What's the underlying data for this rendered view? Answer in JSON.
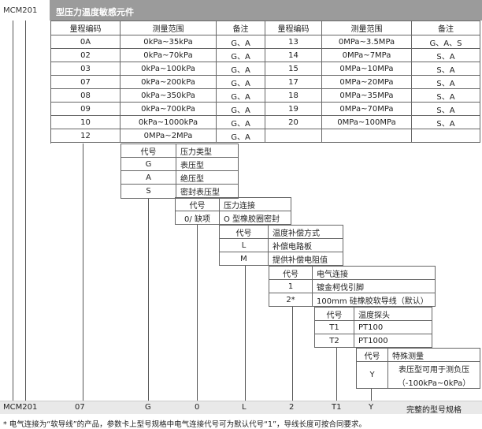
{
  "header": {
    "model": "MCM201",
    "title": "型压力温度敏感元件"
  },
  "range_table": {
    "headers": [
      "量程编码",
      "测量范围",
      "备注",
      "量程编码",
      "测量范围",
      "备注"
    ],
    "left_rows": [
      [
        "0A",
        "0kPa~35kPa",
        "G、A"
      ],
      [
        "02",
        "0kPa~70kPa",
        "G、A"
      ],
      [
        "03",
        "0kPa~100kPa",
        "G、A"
      ],
      [
        "07",
        "0kPa~200kPa",
        "G、A"
      ],
      [
        "08",
        "0kPa~350kPa",
        "G、A"
      ],
      [
        "09",
        "0kPa~700kPa",
        "G、A"
      ],
      [
        "10",
        "0kPa~1000kPa",
        "G、A"
      ],
      [
        "12",
        "0MPa~2MPa",
        "G、A"
      ]
    ],
    "right_rows": [
      [
        "13",
        "0MPa~3.5MPa",
        "G、A、S"
      ],
      [
        "14",
        "0MPa~7MPa",
        "S、A"
      ],
      [
        "15",
        "0MPa~10MPa",
        "S、A"
      ],
      [
        "17",
        "0MPa~20MPa",
        "S、A"
      ],
      [
        "18",
        "0MPa~35MPa",
        "S、A"
      ],
      [
        "19",
        "0MPa~70MPa",
        "S、A"
      ],
      [
        "20",
        "0MPa~100MPa",
        "S、A"
      ]
    ]
  },
  "pressure_type": {
    "code_header": "代号",
    "title": "压力类型",
    "rows": [
      [
        "G",
        "表压型"
      ],
      [
        "A",
        "绝压型"
      ],
      [
        "S",
        "密封表压型"
      ]
    ]
  },
  "pressure_conn": {
    "code_header": "代号",
    "title": "压力连接",
    "rows": [
      [
        "0/ 缺项",
        "O 型橡胶圈密封"
      ]
    ]
  },
  "temp_comp": {
    "code_header": "代号",
    "title": "温度补偿方式",
    "rows": [
      [
        "L",
        "补偿电路板"
      ],
      [
        "M",
        "提供补偿电阻值"
      ]
    ]
  },
  "elec_conn": {
    "code_header": "代号",
    "title": "电气连接",
    "rows": [
      [
        "1",
        "镀金柯伐引脚"
      ],
      [
        "2*",
        "100mm 硅橡胶软导线（默认）"
      ]
    ]
  },
  "temp_probe": {
    "code_header": "代号",
    "title": "温度探头",
    "rows": [
      [
        "T1",
        "PT100"
      ],
      [
        "T2",
        "PT1000"
      ]
    ]
  },
  "special": {
    "code_header": "代号",
    "title": "特殊测量",
    "code": "Y",
    "line1": "表压型可用于测负压",
    "line2": "（-100kPa~0kPa）"
  },
  "example": {
    "parts": [
      "MCM201",
      "07",
      "G",
      "0",
      "L",
      "2",
      "T1",
      "Y"
    ],
    "label": "完整的型号规格"
  },
  "footnote": "* 电气连接为“软导线”的产品，参数卡上型号规格中电气连接代号可为默认代号“1”，导线长度可按合同要求。"
}
